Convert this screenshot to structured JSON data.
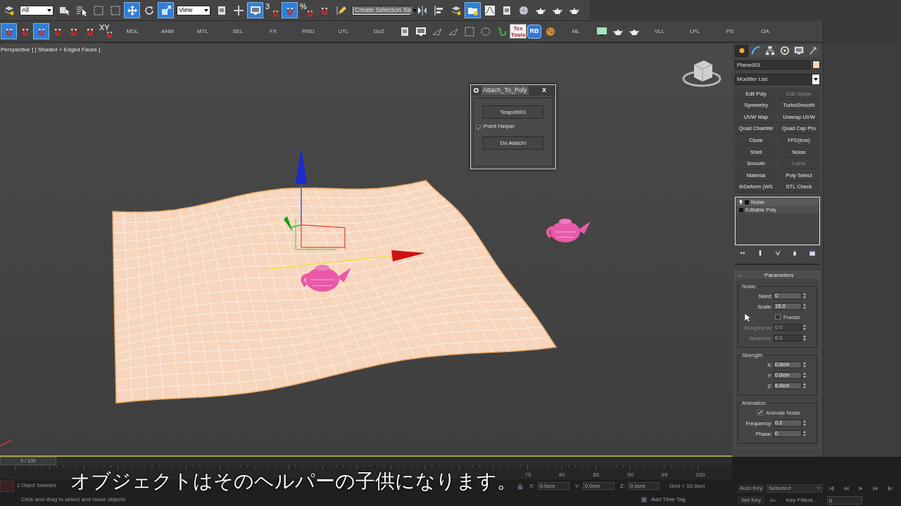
{
  "main_toolbar": [
    {
      "kind": "icon",
      "selected": false
    },
    {
      "kind": "dropdown",
      "value": "All"
    },
    {
      "kind": "icon",
      "selected": false
    },
    {
      "kind": "icon",
      "selected": false
    },
    {
      "kind": "icon",
      "selected": false
    },
    {
      "kind": "icon",
      "selected": false
    },
    {
      "kind": "icon",
      "selected": true
    },
    {
      "kind": "icon",
      "selected": false
    },
    {
      "kind": "icon",
      "selected": true
    },
    {
      "kind": "dropdown",
      "value": "View"
    },
    {
      "kind": "icon",
      "selected": false
    },
    {
      "kind": "icon",
      "selected": false
    },
    {
      "kind": "icon",
      "selected": true
    },
    {
      "kind": "snap",
      "label": "3",
      "selected": false
    },
    {
      "kind": "icon",
      "selected": true
    },
    {
      "kind": "snap",
      "label": "%",
      "selected": false
    },
    {
      "kind": "icon",
      "selected": false
    },
    {
      "kind": "icon",
      "selected": false
    },
    {
      "kind": "named_selection",
      "value": "Create Selection Se"
    },
    {
      "kind": "icon",
      "selected": false
    },
    {
      "kind": "icon",
      "selected": false
    },
    {
      "kind": "icon",
      "selected": false
    },
    {
      "kind": "icon",
      "selected": true
    },
    {
      "kind": "icon",
      "selected": false
    },
    {
      "kind": "icon",
      "selected": false
    },
    {
      "kind": "icon",
      "selected": false
    },
    {
      "kind": "icon",
      "selected": false
    },
    {
      "kind": "icon",
      "selected": false
    },
    {
      "kind": "icon",
      "selected": false
    }
  ],
  "command_toolbar": [
    {
      "kind": "icon",
      "selected": true
    },
    {
      "kind": "icon",
      "selected": false
    },
    {
      "kind": "icon",
      "selected": true
    },
    {
      "kind": "icon",
      "selected": false
    },
    {
      "kind": "icon",
      "selected": false
    },
    {
      "kind": "icon",
      "selected": false
    },
    {
      "kind": "snap",
      "label": "XY",
      "selected": false
    },
    {
      "kind": "tab",
      "label": "MDL"
    },
    {
      "kind": "tab",
      "label": "ANM"
    },
    {
      "kind": "tab",
      "label": "MTL"
    },
    {
      "kind": "tab",
      "label": "SEL"
    },
    {
      "kind": "tab",
      "label": "FX"
    },
    {
      "kind": "tab",
      "label": "RND"
    },
    {
      "kind": "tab",
      "label": "UTL"
    },
    {
      "kind": "tab",
      "label": "GoZ"
    },
    {
      "kind": "icon",
      "selected": false
    },
    {
      "kind": "icon",
      "selected": false
    },
    {
      "kind": "icon",
      "selected": false
    },
    {
      "kind": "icon",
      "selected": false
    },
    {
      "kind": "icon",
      "selected": false
    },
    {
      "kind": "icon",
      "selected": false
    },
    {
      "kind": "icon",
      "selected": false
    },
    {
      "kind": "label_icon",
      "label": "Tex Tools"
    },
    {
      "kind": "badge_icon",
      "label": "RB"
    },
    {
      "kind": "icon",
      "selected": false
    },
    {
      "kind": "tab",
      "label": "ML"
    },
    {
      "kind": "icon",
      "selected": false
    },
    {
      "kind": "icon",
      "selected": false
    },
    {
      "kind": "icon",
      "selected": false
    },
    {
      "kind": "tab",
      "label": "VLL"
    },
    {
      "kind": "tab",
      "label": "LPL"
    },
    {
      "kind": "tab",
      "label": "PS"
    },
    {
      "kind": "tab",
      "label": "OA"
    }
  ],
  "viewport": {
    "label": "Perspective ] [ Shaded + Edged Faces ]"
  },
  "dialog": {
    "title": "Attach_To_Poly",
    "close": "X",
    "pick_button": "Teapot001",
    "checkbox": {
      "label": "Point Helper",
      "checked": true
    },
    "action_button": "Do Atatch!"
  },
  "command_panel": {
    "tabs": [
      {
        "selected": true
      },
      {
        "selected": false
      },
      {
        "selected": false
      },
      {
        "selected": false
      },
      {
        "selected": false
      },
      {
        "selected": false
      }
    ],
    "object_name": "Plane001",
    "modifier_list": "Modifier List",
    "modifier_buttons": [
      {
        "label": "Edit Poly",
        "disabled": false
      },
      {
        "label": "Edit Spline",
        "disabled": true
      },
      {
        "label": "Symmetry",
        "disabled": false
      },
      {
        "label": "TurboSmooth",
        "disabled": false
      },
      {
        "label": "UVW Map",
        "disabled": false
      },
      {
        "label": "Unwrap UVW",
        "disabled": false
      },
      {
        "label": "Quad Chamfer",
        "disabled": false
      },
      {
        "label": "Quad Cap Pro",
        "disabled": false
      },
      {
        "label": "Clone",
        "disabled": false
      },
      {
        "label": "FFD(box)",
        "disabled": false
      },
      {
        "label": "Shell",
        "disabled": false
      },
      {
        "label": "Noise",
        "disabled": false
      },
      {
        "label": "Smooth",
        "disabled": false
      },
      {
        "label": "Lathe",
        "disabled": true
      },
      {
        "label": "Material",
        "disabled": false
      },
      {
        "label": "Poly Select",
        "disabled": false
      },
      {
        "label": "thDeform (WS",
        "disabled": false
      },
      {
        "label": "STL Check",
        "disabled": false
      }
    ],
    "stack": [
      {
        "label": "Noise",
        "selected": true
      },
      {
        "label": "Editable Poly",
        "selected": false
      }
    ],
    "parameters": {
      "collapse": "–",
      "title": "Parameters",
      "groups": [
        {
          "title": "Noise:",
          "rows": [
            {
              "kind": "spinner",
              "label": "Seed:",
              "value": "0",
              "disabled": false
            },
            {
              "kind": "spinner",
              "label": "Scale:",
              "value": "15.0",
              "disabled": false
            },
            {
              "kind": "checkbox",
              "label": "Fractal",
              "checked": false
            },
            {
              "kind": "spinner",
              "label": "Roughness:",
              "value": "0.0",
              "disabled": true
            },
            {
              "kind": "spinner",
              "label": "Iterations:",
              "value": "6.0",
              "disabled": true
            }
          ]
        },
        {
          "title": "Strength:",
          "rows": [
            {
              "kind": "spinner",
              "label": "X:",
              "value": "0.0cm",
              "disabled": false
            },
            {
              "kind": "spinner",
              "label": "Y:",
              "value": "0.0cm",
              "disabled": false
            },
            {
              "kind": "spinner",
              "label": "Z:",
              "value": "6.0cm",
              "disabled": false
            }
          ]
        },
        {
          "title": "Animation:",
          "rows": [
            {
              "kind": "checkbox",
              "label": "Animate Noise",
              "checked": true
            },
            {
              "kind": "spinner",
              "label": "Frequency:",
              "value": "0.2",
              "disabled": false
            },
            {
              "kind": "spinner",
              "label": "Phase:",
              "value": "0",
              "disabled": false
            }
          ]
        }
      ]
    }
  },
  "timeline": {
    "frame": "0 / 100",
    "level": 0,
    "ruler_labels": [
      "75",
      "80",
      "85",
      "90",
      "95",
      "100"
    ]
  },
  "status": {
    "selection": "1 Object Selected",
    "prompt": "Click and drag to select and move objects",
    "coords": [
      {
        "axis": "X:",
        "value": "0.0cm"
      },
      {
        "axis": "Y:",
        "value": "0.0cm"
      },
      {
        "axis": "Z:",
        "value": "0.0cm"
      }
    ],
    "grid": "Grid = 10.0cm",
    "time_tag": "Add Time Tag"
  },
  "animation": {
    "auto_key": "Auto Key",
    "key_mode": "Selected",
    "set_key": "Set Key",
    "key_filters": "Key Filters...",
    "frame": "0"
  },
  "subtitle": "オブジェクトはそのヘルパーの子供になります。"
}
